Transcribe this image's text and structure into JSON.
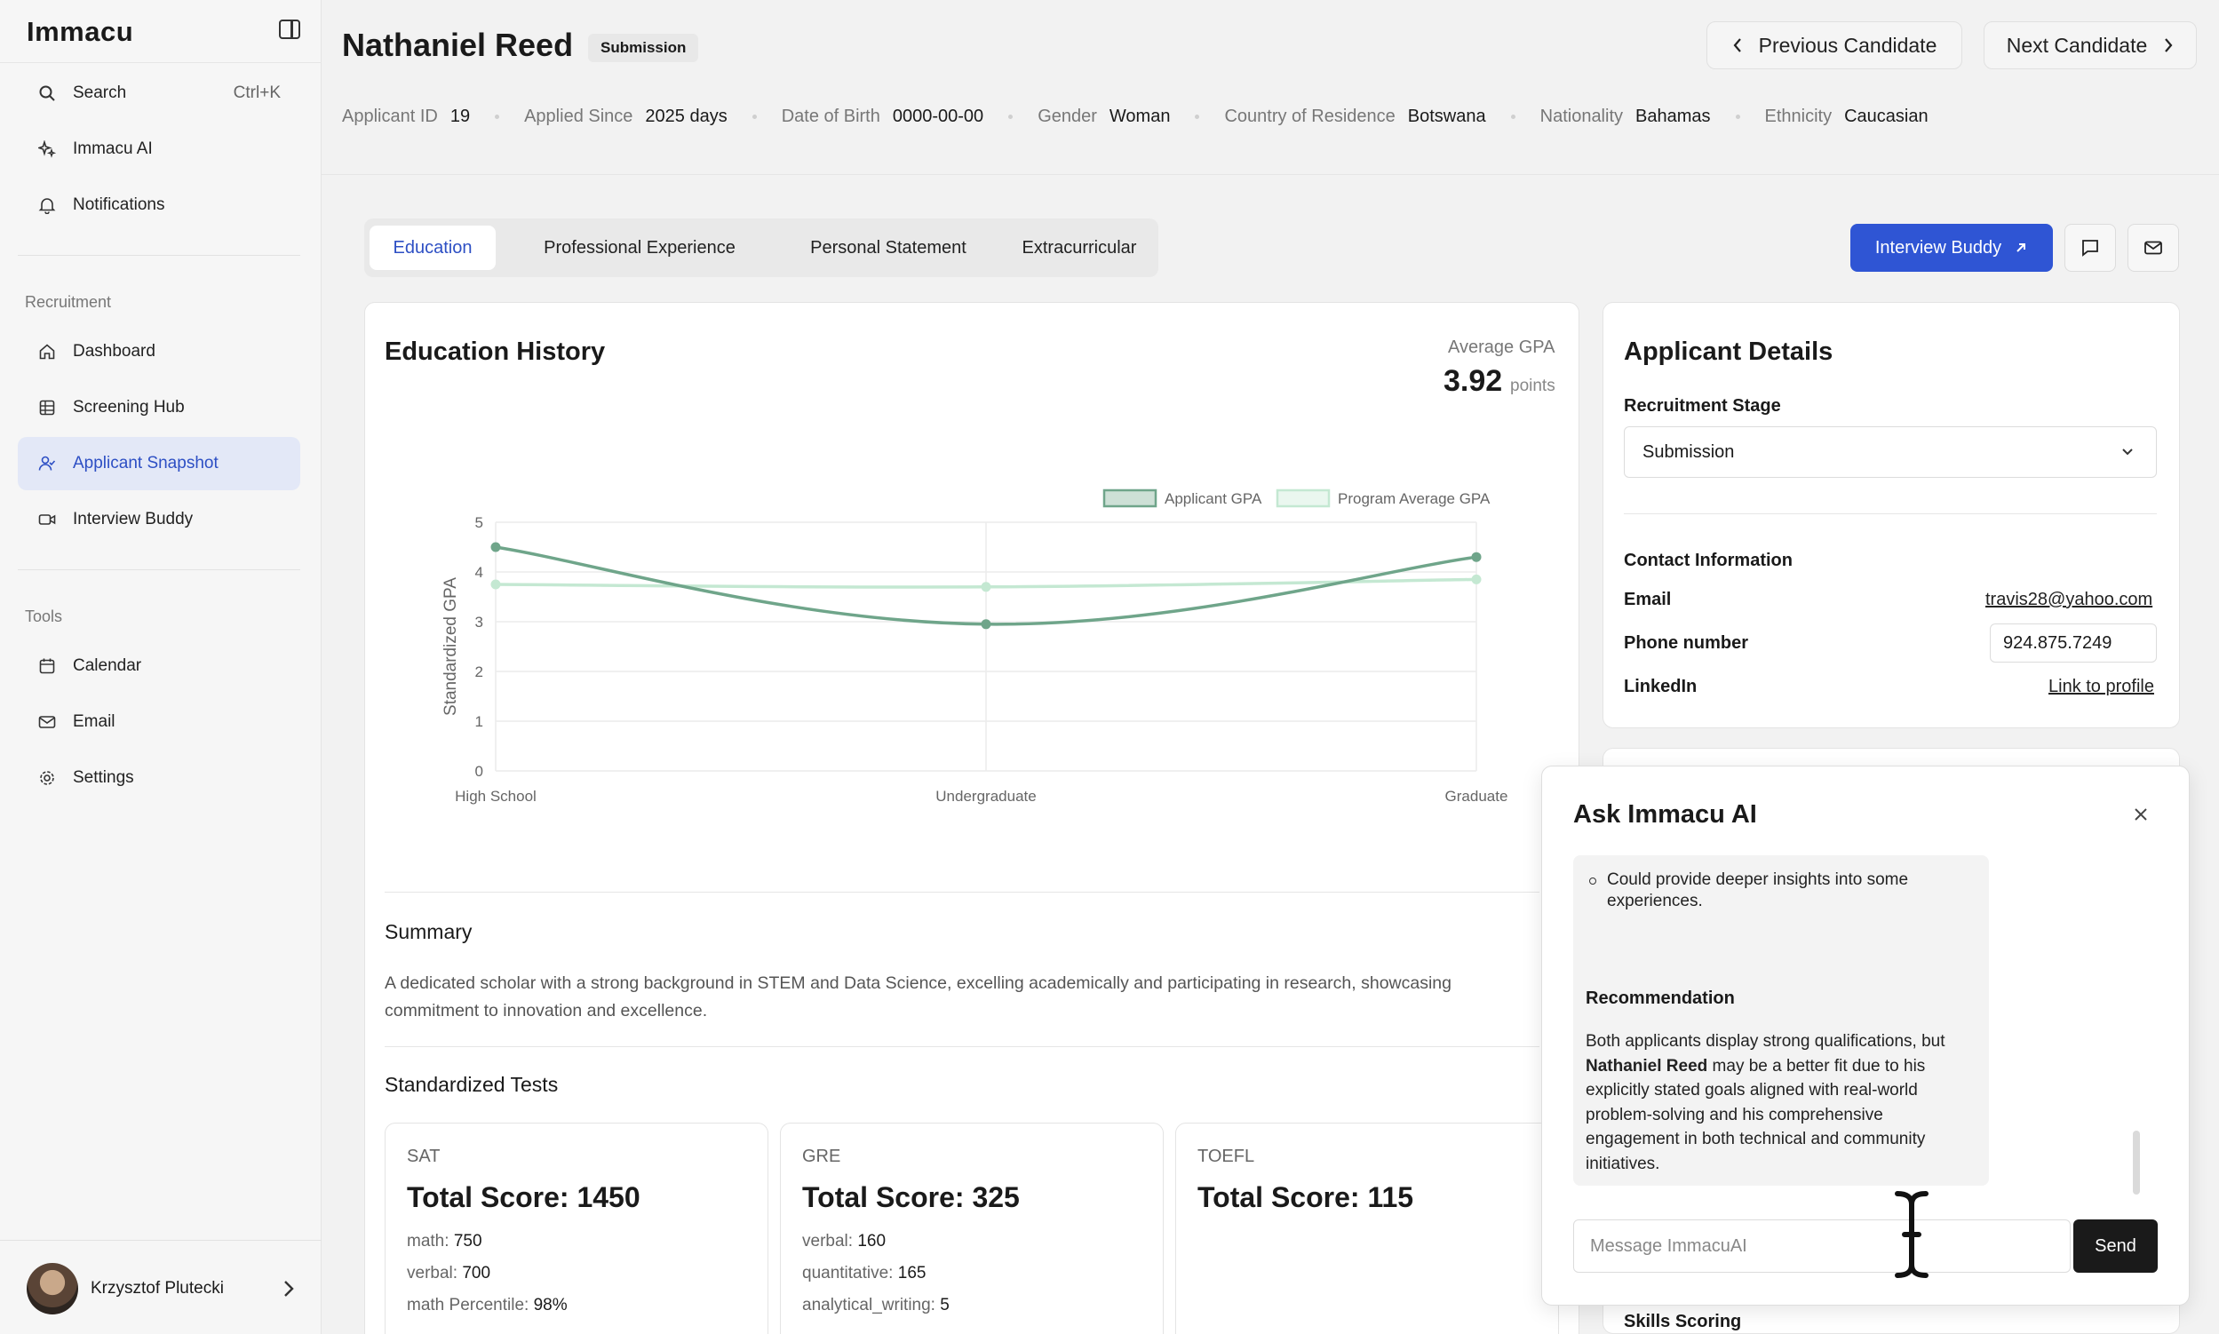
{
  "app": {
    "logo": "Immacu"
  },
  "sidebar": {
    "search": {
      "label": "Search",
      "shortcut": "Ctrl+K"
    },
    "top_items": [
      {
        "label": "Immacu AI",
        "icon": "sparkle-icon"
      },
      {
        "label": "Notifications",
        "icon": "bell-icon"
      }
    ],
    "recruitment_label": "Recruitment",
    "recruitment_items": [
      {
        "label": "Dashboard",
        "icon": "home-icon"
      },
      {
        "label": "Screening Hub",
        "icon": "grid-icon"
      },
      {
        "label": "Applicant Snapshot",
        "icon": "user-check-icon",
        "active": true
      },
      {
        "label": "Interview Buddy",
        "icon": "video-icon"
      }
    ],
    "tools_label": "Tools",
    "tools_items": [
      {
        "label": "Calendar",
        "icon": "calendar-icon"
      },
      {
        "label": "Email",
        "icon": "mail-icon"
      },
      {
        "label": "Settings",
        "icon": "gear-icon"
      }
    ],
    "user": {
      "name": "Krzysztof Plutecki"
    }
  },
  "header": {
    "name": "Nathaniel Reed",
    "badge": "Submission",
    "prev_label": "Previous Candidate",
    "next_label": "Next Candidate",
    "meta": [
      {
        "key": "Applicant ID",
        "value": "19"
      },
      {
        "key": "Applied Since",
        "value": "2025 days"
      },
      {
        "key": "Date of Birth",
        "value": "0000-00-00"
      },
      {
        "key": "Gender",
        "value": "Woman"
      },
      {
        "key": "Country of Residence",
        "value": "Botswana"
      },
      {
        "key": "Nationality",
        "value": "Bahamas"
      },
      {
        "key": "Ethnicity",
        "value": "Caucasian"
      }
    ]
  },
  "tabs": [
    "Education",
    "Professional Experience",
    "Personal Statement",
    "Extracurricular"
  ],
  "actions": {
    "interview_buddy": "Interview Buddy"
  },
  "education": {
    "title": "Education History",
    "avg_label": "Average GPA",
    "avg_value": "3.92",
    "avg_unit": "points",
    "summary_title": "Summary",
    "summary_text": "A dedicated scholar with a strong background in STEM and Data Science, excelling academically and participating in research, showcasing commitment to innovation and excellence.",
    "tests_title": "Standardized Tests",
    "tests": [
      {
        "name": "SAT",
        "total": "Total Score: 1450",
        "lines": [
          {
            "k": "math:",
            "v": "750"
          },
          {
            "k": "verbal:",
            "v": "700"
          },
          {
            "k": "math Percentile:",
            "v": "98%"
          }
        ]
      },
      {
        "name": "GRE",
        "total": "Total Score: 325",
        "lines": [
          {
            "k": "verbal:",
            "v": "160"
          },
          {
            "k": "quantitative:",
            "v": "165"
          },
          {
            "k": "analytical_writing:",
            "v": "5"
          }
        ]
      },
      {
        "name": "TOEFL",
        "total": "Total Score: 115",
        "lines": []
      }
    ]
  },
  "chart_data": {
    "type": "line",
    "categories": [
      "High School",
      "Undergraduate",
      "Graduate"
    ],
    "series": [
      {
        "name": "Applicant GPA",
        "values": [
          4.5,
          2.95,
          4.3
        ],
        "color": "#6fa58a"
      },
      {
        "name": "Program Average GPA",
        "values": [
          3.75,
          3.7,
          3.85
        ],
        "color": "#c4e8d2"
      }
    ],
    "ylabel": "Standardized GPA",
    "ylim": [
      0,
      5
    ],
    "yticks": [
      "0",
      "1",
      "2",
      "3",
      "4",
      "5"
    ],
    "legend": "top-right",
    "grid": true
  },
  "details": {
    "title": "Applicant Details",
    "stage_label": "Recruitment Stage",
    "stage_value": "Submission",
    "contact_title": "Contact Information",
    "email_label": "Email",
    "email_value": "travis28@yahoo.com",
    "phone_label": "Phone number",
    "phone_value": "924.875.7249",
    "linkedin_label": "LinkedIn",
    "linkedin_value": "Link to profile",
    "skills_label": "Skills Scoring"
  },
  "ai": {
    "title": "Ask Immacu AI",
    "bullet": "Could provide deeper insights into some experiences.",
    "rec_title": "Recommendation",
    "rec_pre": "Both applicants display strong qualifications, but",
    "rec_name": "Nathaniel Reed",
    "rec_post": "may be a better fit due to his explicitly stated goals aligned with real-world problem-solving and his comprehensive engagement in both technical and community initiatives.",
    "placeholder": "Message ImmacuAI",
    "send": "Send"
  },
  "colors": {
    "accent": "#2f55d4",
    "active_bg": "#e3e8f7"
  }
}
